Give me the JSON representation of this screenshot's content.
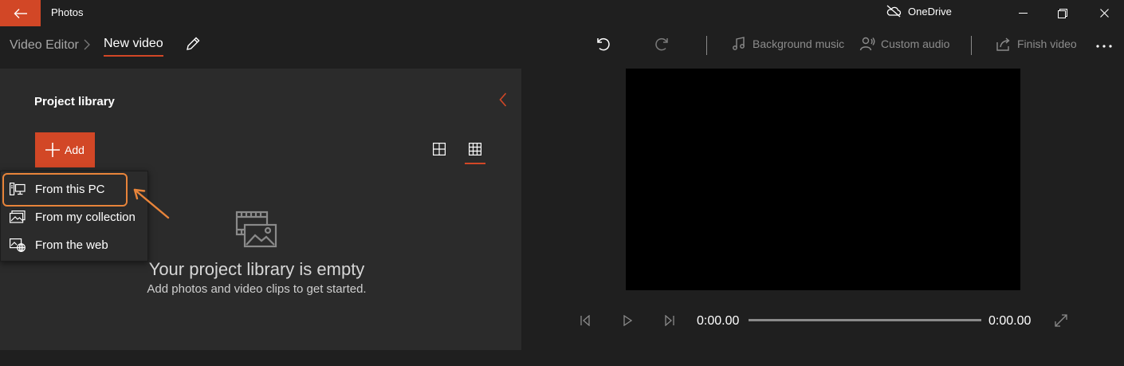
{
  "app": {
    "title": "Photos"
  },
  "onedrive": {
    "label": "OneDrive"
  },
  "breadcrumb": {
    "root": "Video Editor",
    "current": "New video"
  },
  "toolbar": {
    "background_music": "Background music",
    "custom_audio": "Custom audio",
    "finish_video": "Finish video"
  },
  "library": {
    "title": "Project library",
    "add_label": "Add",
    "empty_title": "Your project library is empty",
    "empty_subtitle": "Add photos and video clips to get started."
  },
  "add_menu": {
    "items": [
      {
        "label": "From this PC",
        "icon": "pc-icon",
        "highlighted": true
      },
      {
        "label": "From my collection",
        "icon": "collection-icon"
      },
      {
        "label": "From the web",
        "icon": "web-icon"
      }
    ]
  },
  "playback": {
    "current_time": "0:00.00",
    "total_time": "0:00.00",
    "progress": 0
  },
  "colors": {
    "accent": "#d24726",
    "callout": "#e8843a",
    "background": "#1f1f1f",
    "panel": "#2b2b2b"
  },
  "icons": [
    "back-arrow-icon",
    "onedrive-off-icon",
    "minimize-icon",
    "maximize-icon",
    "close-icon",
    "chevron-right-icon",
    "pencil-icon",
    "undo-icon",
    "redo-icon",
    "music-note-icon",
    "person-audio-icon",
    "share-icon",
    "more-icon",
    "chevron-left-icon",
    "plus-icon",
    "large-grid-icon",
    "small-grid-icon",
    "empty-media-icon",
    "previous-frame-icon",
    "play-icon",
    "next-frame-icon",
    "fullscreen-icon"
  ]
}
